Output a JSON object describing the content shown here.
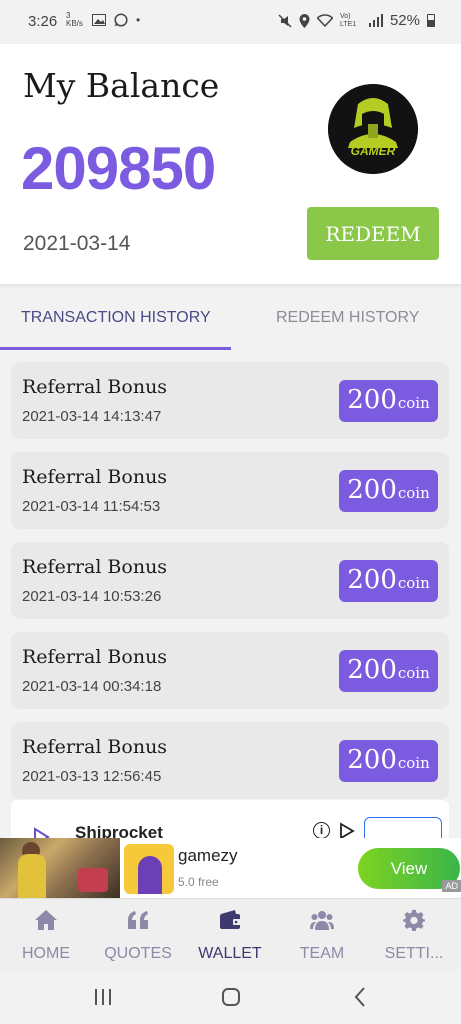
{
  "status_bar": {
    "time": "3:26",
    "net_speed": "3 KB/s",
    "network_label": "Vo) LTE1",
    "battery": "52%"
  },
  "balance": {
    "title": "My Balance",
    "amount": "209850",
    "date": "2021-03-14",
    "redeem_label": "REDEEM",
    "avatar_text": "GAMER"
  },
  "tabs": {
    "transaction_history": "TRANSACTION HISTORY",
    "redeem_history": "REDEEM HISTORY"
  },
  "transactions": [
    {
      "title": "Referral Bonus",
      "time": "2021-03-14 14:13:47",
      "amount": "200",
      "unit": "coin"
    },
    {
      "title": "Referral Bonus",
      "time": "2021-03-14 11:54:53",
      "amount": "200",
      "unit": "coin"
    },
    {
      "title": "Referral Bonus",
      "time": "2021-03-14 10:53:26",
      "amount": "200",
      "unit": "coin"
    },
    {
      "title": "Referral Bonus",
      "time": "2021-03-14 00:34:18",
      "amount": "200",
      "unit": "coin"
    },
    {
      "title": "Referral Bonus",
      "time": "2021-03-13 12:56:45",
      "amount": "200",
      "unit": "coin"
    }
  ],
  "native_ad": {
    "name": "Shiprocket"
  },
  "banner_ad": {
    "name": "gamezy",
    "subtitle": "5.0 free",
    "cta": "View",
    "tag": "AD"
  },
  "bottom_nav": [
    {
      "label": "HOME",
      "icon": "home-icon"
    },
    {
      "label": "QUOTES",
      "icon": "quotes-icon"
    },
    {
      "label": "WALLET",
      "icon": "wallet-icon"
    },
    {
      "label": "TEAM",
      "icon": "team-icon"
    },
    {
      "label": "SETTI...",
      "icon": "settings-icon"
    }
  ],
  "colors": {
    "accent": "#7b5ce0",
    "redeem_green": "#8bc84a",
    "tab_active": "#4b4a84",
    "nav_active": "#3d3a6e"
  }
}
